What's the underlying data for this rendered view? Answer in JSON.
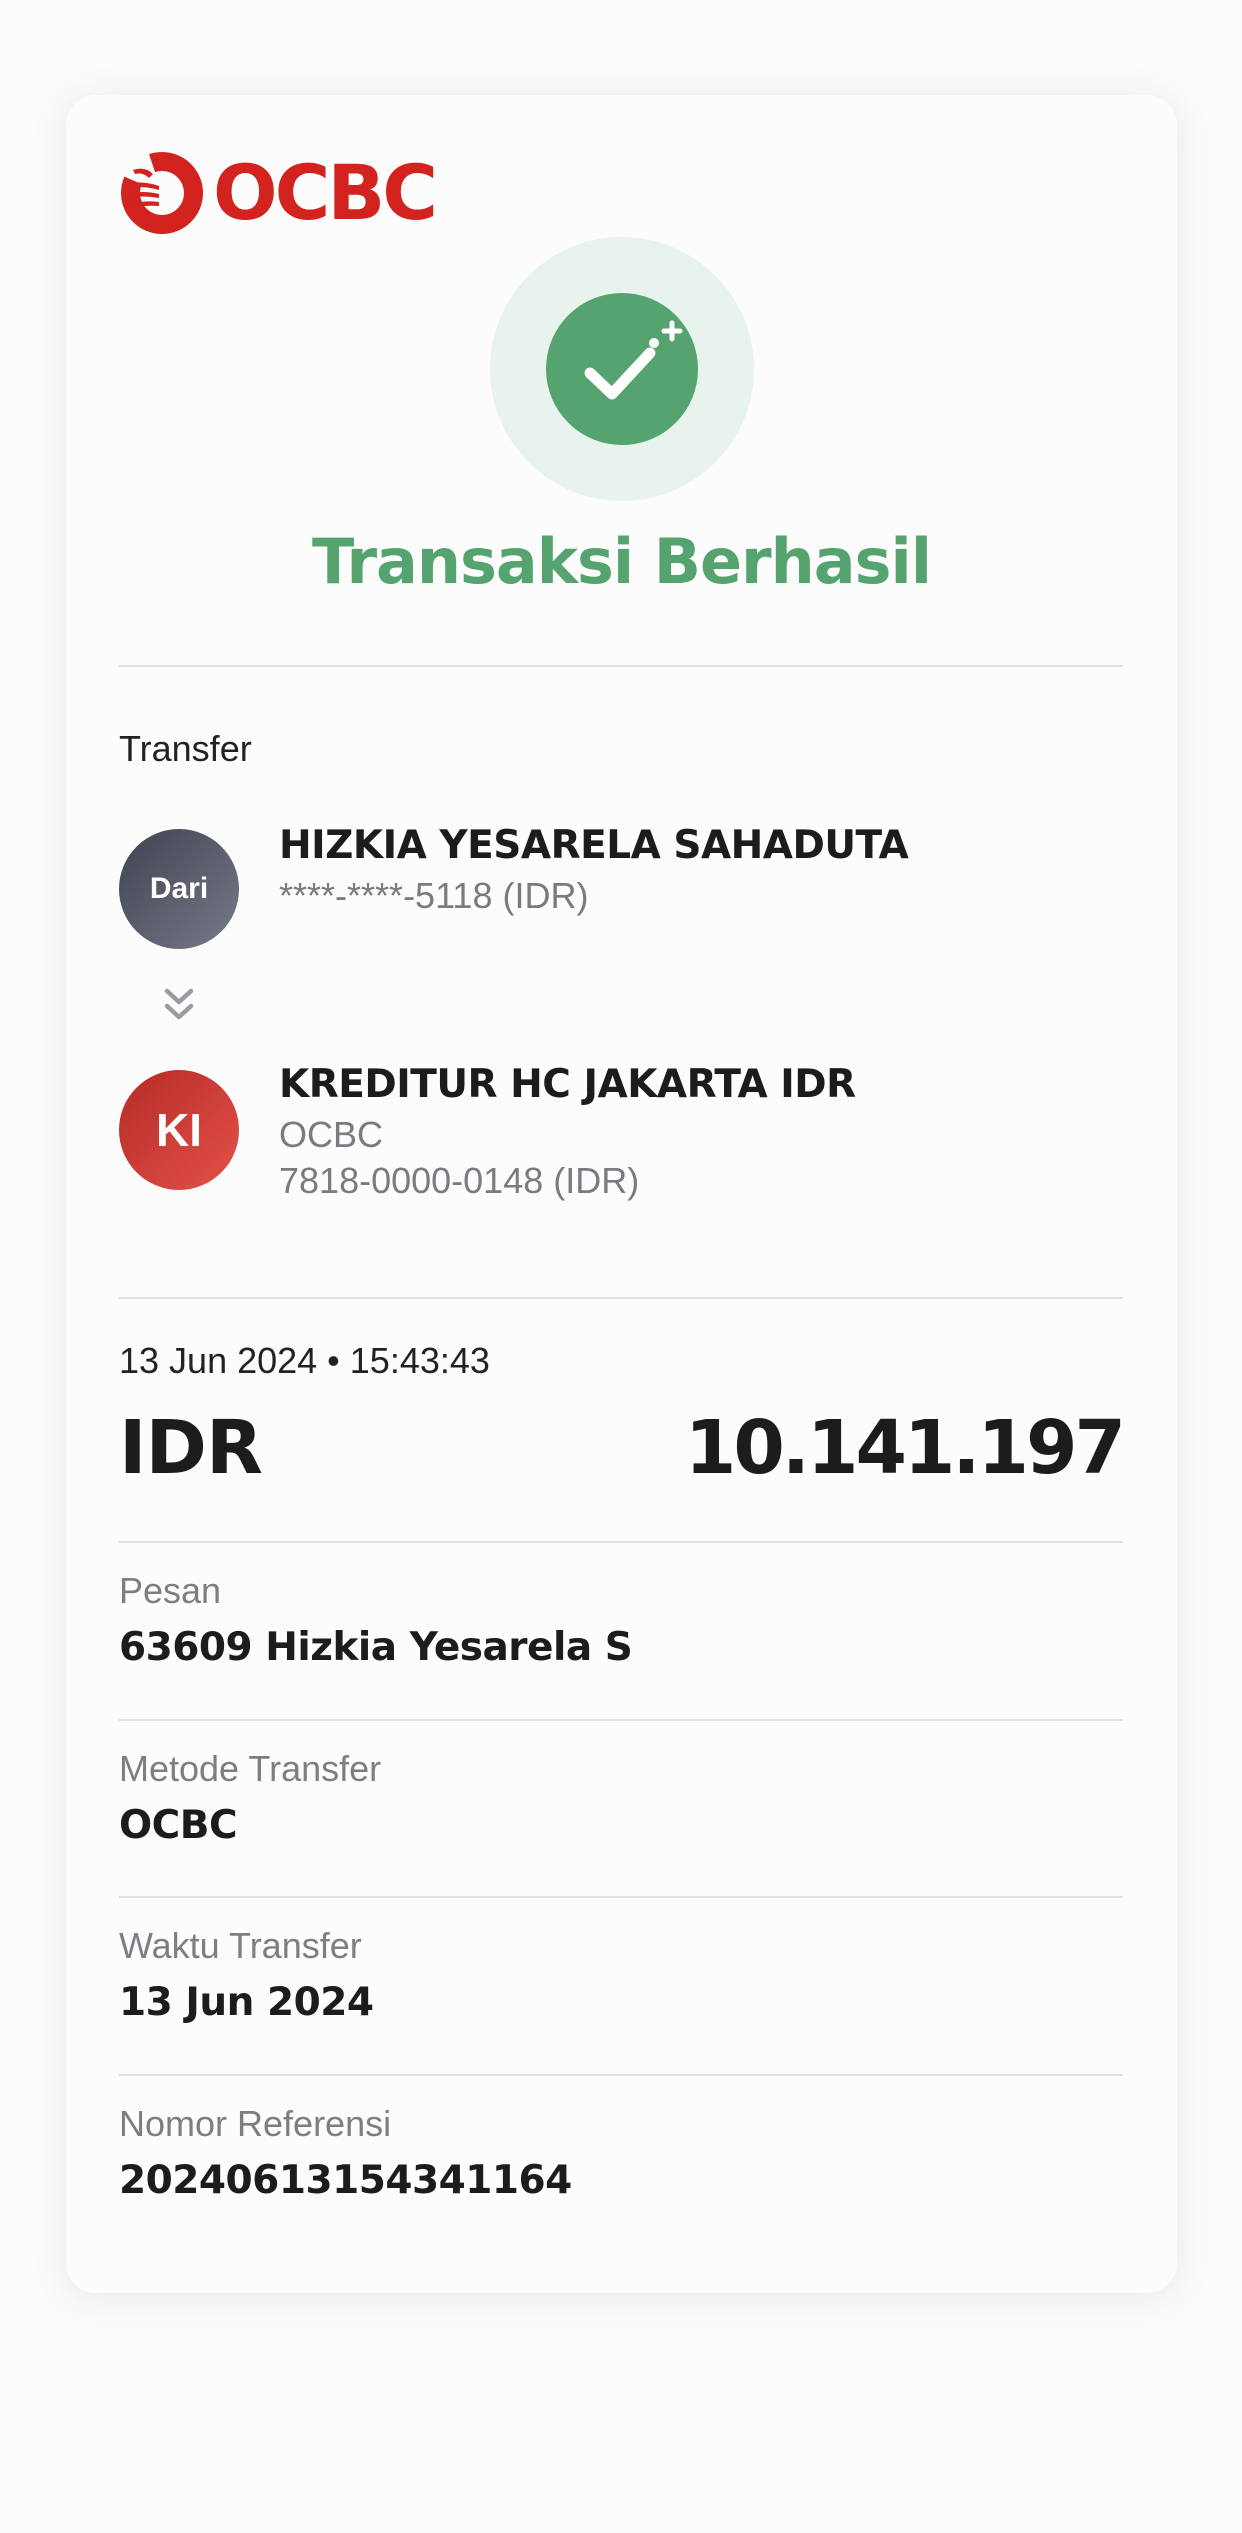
{
  "brand": {
    "name": "OCBC",
    "color": "#d3231e",
    "logo_icon": "ocbc-sail-icon"
  },
  "status": {
    "title": "Transaksi Berhasil",
    "icon": "check-sparkle-icon",
    "color": "#55a36e"
  },
  "transfer": {
    "section_label": "Transfer",
    "from": {
      "avatar_label": "Dari",
      "name": "HIZKIA YESARELA SAHADUTA",
      "account": "****-****-5118 (IDR)"
    },
    "arrow_icon": "double-chevron-down-icon",
    "to": {
      "avatar_label": "KI",
      "name": "KREDITUR HC JAKARTA IDR",
      "bank": "OCBC",
      "account": "7818-0000-0148 (IDR)"
    }
  },
  "summary": {
    "datetime": "13 Jun 2024 • 15:43:43",
    "currency": "IDR",
    "amount": "10.141.197"
  },
  "details": [
    {
      "label": "Pesan",
      "value": "63609 Hizkia Yesarela S"
    },
    {
      "label": "Metode Transfer",
      "value": "OCBC"
    },
    {
      "label": "Waktu Transfer",
      "value": "13 Jun 2024"
    },
    {
      "label": "Nomor Referensi",
      "value": "20240613154341164"
    }
  ]
}
